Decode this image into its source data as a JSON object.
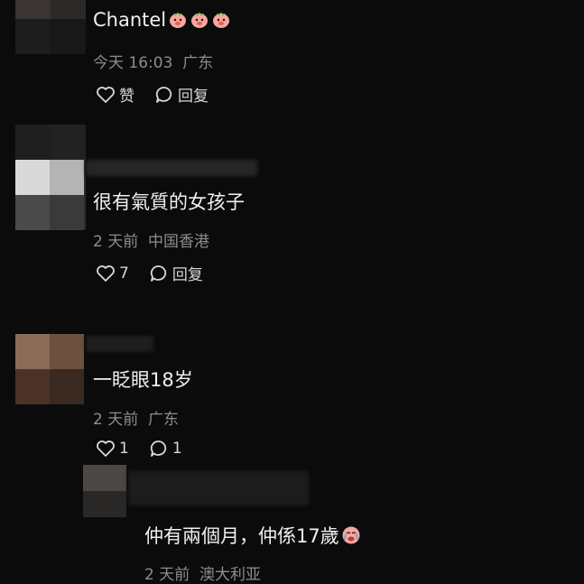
{
  "comments": [
    {
      "text": "Chantel",
      "meta_time": "今天 16:03",
      "meta_location": "广东",
      "like_label": "赞",
      "reply_label": "回复"
    },
    {
      "text": "很有氣質的女孩子",
      "meta_time": "2 天前",
      "meta_location": "中国香港",
      "like_count": "7",
      "reply_label": "回复"
    },
    {
      "text": "一眨眼18岁",
      "meta_time": "2 天前",
      "meta_location": "广东",
      "like_count": "1",
      "reply_count": "1"
    },
    {
      "text": "仲有兩個月，仲係17歲",
      "meta_time": "2 天前",
      "meta_location": "澳大利亚"
    }
  ],
  "icons": {
    "like": "heart-outline-icon",
    "reply": "speech-bubble-icon",
    "emoji_peach": "pig-face-emoji-icon",
    "emoji_cry": "crying-face-emoji-icon"
  },
  "colors": {
    "background": "#0b0b0b",
    "text": "#f0f0f0",
    "meta": "#8d8d8d",
    "emoji_pink": "#f7a7a0"
  }
}
